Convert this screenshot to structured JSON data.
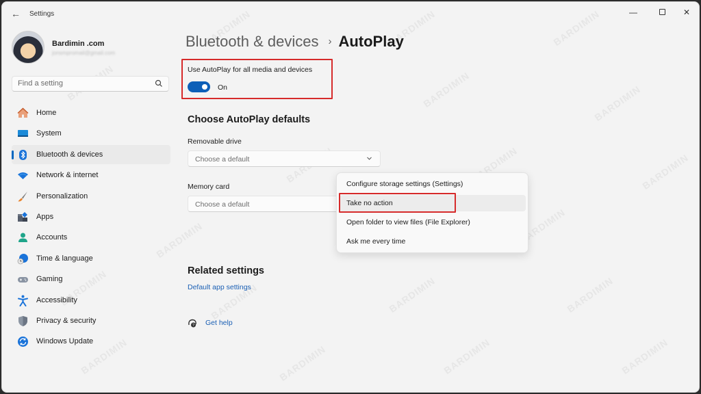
{
  "window": {
    "app_title": "Settings",
    "controls": {
      "minimize": "—",
      "maximize": "",
      "close": "✕"
    },
    "back_icon": "←"
  },
  "profile": {
    "name": "Bardimin .com",
    "email": "jonsmpromail@gmail.com"
  },
  "search": {
    "placeholder": "Find a setting",
    "value": ""
  },
  "sidebar": {
    "items": [
      {
        "id": "home",
        "label": "Home",
        "icon": "home-icon",
        "active": false
      },
      {
        "id": "system",
        "label": "System",
        "icon": "system-icon",
        "active": false
      },
      {
        "id": "bluetooth",
        "label": "Bluetooth & devices",
        "icon": "bluetooth-icon",
        "active": true
      },
      {
        "id": "network",
        "label": "Network & internet",
        "icon": "wifi-icon",
        "active": false
      },
      {
        "id": "personalization",
        "label": "Personalization",
        "icon": "brush-icon",
        "active": false
      },
      {
        "id": "apps",
        "label": "Apps",
        "icon": "apps-icon",
        "active": false
      },
      {
        "id": "accounts",
        "label": "Accounts",
        "icon": "person-icon",
        "active": false
      },
      {
        "id": "time",
        "label": "Time & language",
        "icon": "globe-clock-icon",
        "active": false
      },
      {
        "id": "gaming",
        "label": "Gaming",
        "icon": "gamepad-icon",
        "active": false
      },
      {
        "id": "accessibility",
        "label": "Accessibility",
        "icon": "accessibility-icon",
        "active": false
      },
      {
        "id": "privacy",
        "label": "Privacy & security",
        "icon": "shield-icon",
        "active": false
      },
      {
        "id": "update",
        "label": "Windows Update",
        "icon": "update-icon",
        "active": false
      }
    ]
  },
  "breadcrumb": {
    "parent": "Bluetooth & devices",
    "separator": "›",
    "current": "AutoPlay"
  },
  "autoplay_toggle": {
    "label": "Use AutoPlay for all media and devices",
    "state": "On",
    "checked": true
  },
  "defaults_section": {
    "title": "Choose AutoPlay defaults",
    "removable_drive": {
      "label": "Removable drive",
      "value": "Choose a default"
    },
    "memory_card": {
      "label": "Memory card",
      "value": "Choose a default"
    }
  },
  "dropdown": {
    "options": [
      "Configure storage settings (Settings)",
      "Take no action",
      "Open folder to view files (File Explorer)",
      "Ask me every time"
    ],
    "hovered_index": 1
  },
  "related": {
    "title": "Related settings",
    "link": "Default app settings"
  },
  "help": {
    "label": "Get help"
  },
  "annotation_color": "#d62a2a",
  "accent_color": "#0d5fb8",
  "watermark": "BARDIMIN"
}
